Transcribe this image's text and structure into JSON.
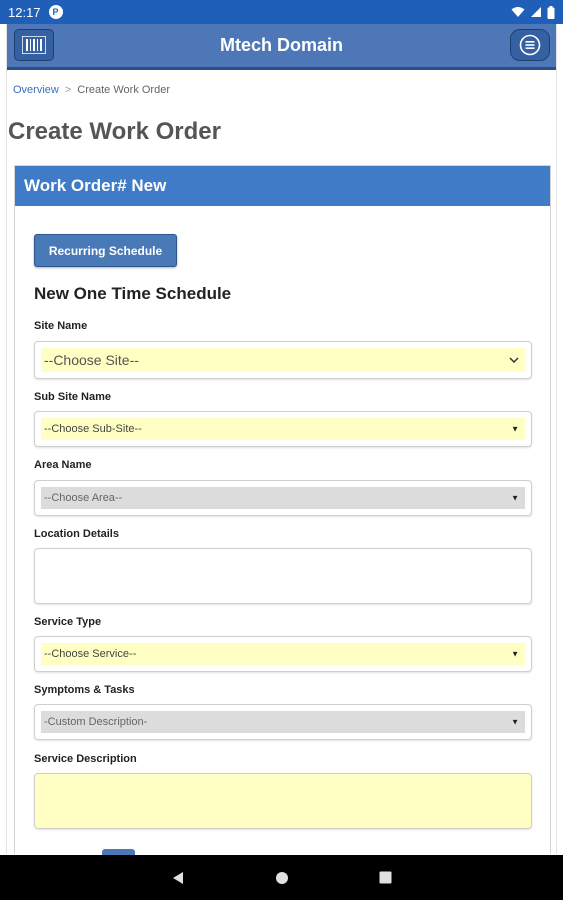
{
  "status_bar": {
    "time": "12:17",
    "notification_icon": "app-notification-icon",
    "icons": [
      "wifi-icon",
      "signal-icon",
      "battery-icon"
    ]
  },
  "topbar": {
    "title": "Mtech Domain",
    "left_icon": "barcode-icon",
    "right_icon": "menu-icon"
  },
  "breadcrumb": {
    "items": [
      "Overview",
      "Create Work Order"
    ],
    "separator": ">"
  },
  "page_title": "Create Work Order",
  "panel": {
    "header": "Work Order# New",
    "recurring_button": "Recurring Schedule",
    "section_title": "New One Time Schedule",
    "fields": {
      "site_name": {
        "label": "Site Name",
        "value": "--Choose Site--"
      },
      "sub_site_name": {
        "label": "Sub Site Name",
        "value": "--Choose Sub-Site--"
      },
      "area_name": {
        "label": "Area Name",
        "value": "--Choose Area--"
      },
      "location_details": {
        "label": "Location Details",
        "value": ""
      },
      "service_type": {
        "label": "Service Type",
        "value": "--Choose Service--"
      },
      "symptoms_tasks": {
        "label": "Symptoms & Tasks",
        "value": "-Custom Description-"
      },
      "service_description": {
        "label": "Service Description",
        "value": ""
      }
    }
  },
  "colors": {
    "status_bar": "#1f5fb8",
    "topbar": "#4d77b6",
    "panel_header": "#3f7bc7",
    "field_highlight": "#ffffc4",
    "field_disabled": "#dcdcdc"
  },
  "navbar": {
    "icons": [
      "back-icon",
      "home-icon",
      "recents-icon"
    ]
  }
}
